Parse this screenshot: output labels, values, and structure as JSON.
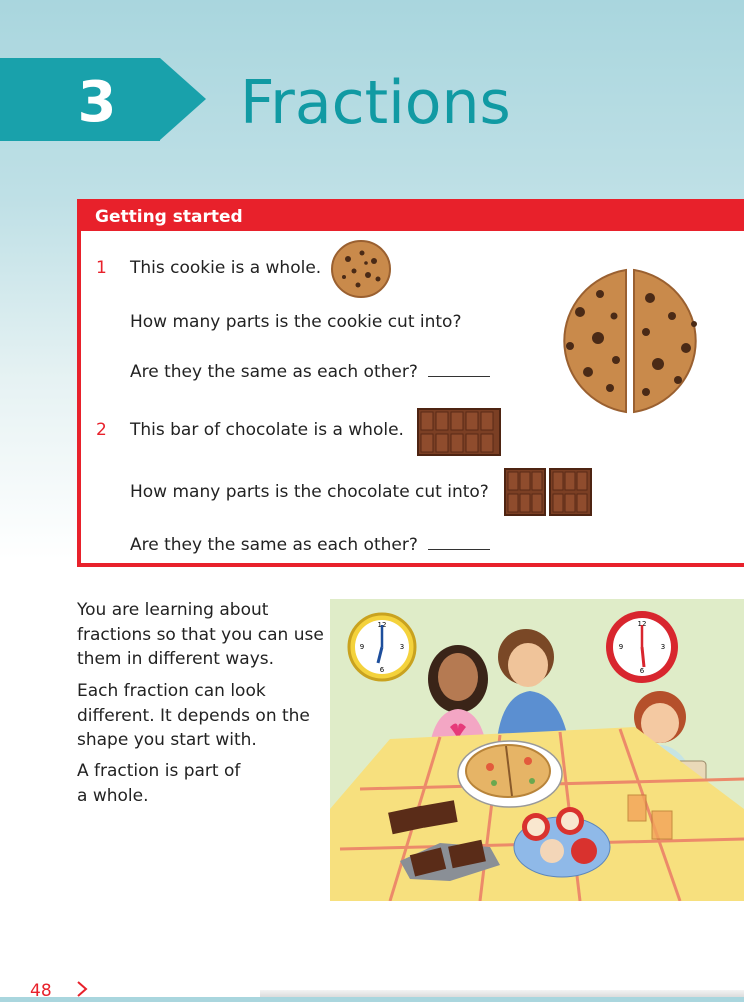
{
  "chapter": {
    "number": "3",
    "title": "Fractions"
  },
  "getting_started": {
    "header": "Getting started",
    "q1": {
      "number": "1",
      "statement": "This cookie is a whole.",
      "question_a": "How many parts is the cookie cut into?",
      "question_b": "Are they the same as each other?"
    },
    "q2": {
      "number": "2",
      "statement": "This bar of chocolate is a whole.",
      "question_a": "How many parts is the chocolate cut into?",
      "question_b": "Are they the same as each other?"
    }
  },
  "intro": {
    "para1": "You are learning about fractions so that you can use them in different ways.",
    "para2": "Each fraction can look different. It depends on the shape you start with.",
    "para3": "A fraction is part of a whole."
  },
  "illustration": {
    "clock_numbers": [
      "12",
      "1",
      "2",
      "3",
      "4",
      "5",
      "6",
      "7",
      "8",
      "9",
      "10",
      "11"
    ]
  },
  "footer": {
    "page_number": "48"
  },
  "colors": {
    "teal": "#19a1ab",
    "red": "#e8212b",
    "cookie": "#c98a4b",
    "chocolate": "#7b3f24"
  }
}
